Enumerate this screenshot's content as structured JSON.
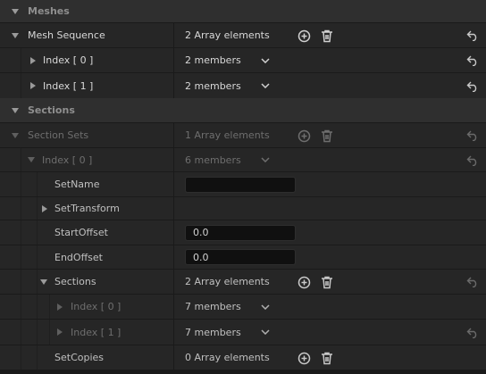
{
  "categories": {
    "meshes": "Meshes",
    "sections": "Sections"
  },
  "mesh_sequence": {
    "label": "Mesh Sequence",
    "value": "2 Array elements",
    "items": [
      {
        "label": "Index [ 0 ]",
        "value": "2 members"
      },
      {
        "label": "Index [ 1 ]",
        "value": "2 members"
      }
    ]
  },
  "section_sets": {
    "label": "Section Sets",
    "value": "1 Array elements",
    "index0": {
      "label": "Index [ 0 ]",
      "value": "6 members"
    },
    "set_name": {
      "label": "SetName",
      "value": ""
    },
    "set_transform": {
      "label": "SetTransform"
    },
    "start_offset": {
      "label": "StartOffset",
      "value": "0.0"
    },
    "end_offset": {
      "label": "EndOffset",
      "value": "0.0"
    },
    "sections": {
      "label": "Sections",
      "value": "2 Array elements",
      "items": [
        {
          "label": "Index [ 0 ]",
          "value": "7 members"
        },
        {
          "label": "Index [ 1 ]",
          "value": "7 members"
        }
      ]
    },
    "set_copies": {
      "label": "SetCopies",
      "value": "0 Array elements"
    }
  },
  "icons": {
    "add": "add-element-icon",
    "delete": "delete-all-icon",
    "reset": "reset-to-default-icon",
    "dropdown": "chevron-down-icon"
  },
  "colors": {
    "background": "#1a1a1a",
    "row": "#262626",
    "category": "#2f2f2f",
    "text": "#c0c0c0",
    "text_dim": "#6e6e6e"
  }
}
